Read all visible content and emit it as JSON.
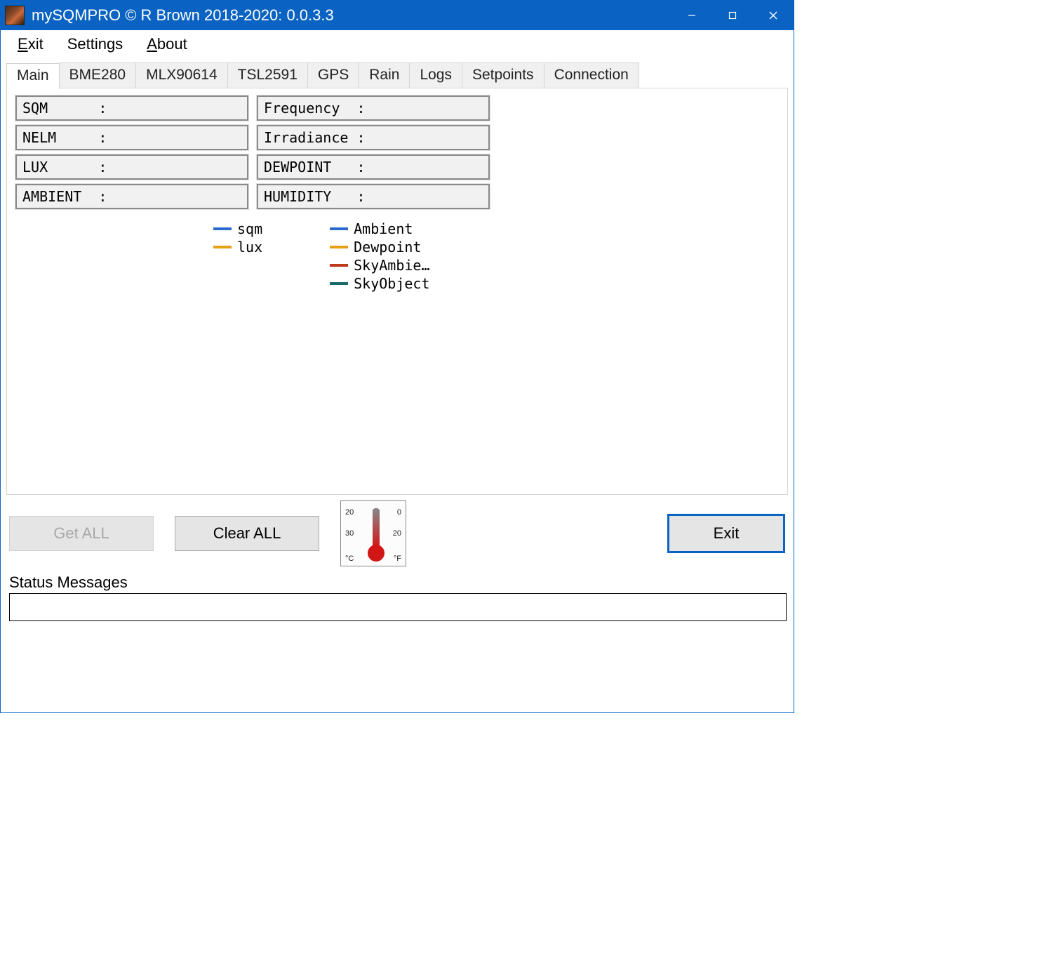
{
  "window": {
    "title": "mySQMPRO © R Brown 2018-2020: 0.0.3.3"
  },
  "menu": {
    "exit": "Exit",
    "settings": "Settings",
    "about": "About"
  },
  "tabs": {
    "main": "Main",
    "bme280": "BME280",
    "mlx90614": "MLX90614",
    "tsl2591": "TSL2591",
    "gps": "GPS",
    "rain": "Rain",
    "logs": "Logs",
    "setpoints": "Setpoints",
    "connection": "Connection"
  },
  "readouts": {
    "left": {
      "sqm": "SQM      :",
      "nelm": "NELM     :",
      "lux": "LUX      :",
      "ambient": "AMBIENT  :"
    },
    "right": {
      "frequency": "Frequency  :",
      "irradiance": "Irradiance :",
      "dewpoint": "DEWPOINT   :",
      "humidity": "HUMIDITY   :"
    }
  },
  "legend": {
    "left": [
      {
        "label": "sqm",
        "color": "#2a6ad0"
      },
      {
        "label": "lux",
        "color": "#e6a018"
      }
    ],
    "right": [
      {
        "label": "Ambient",
        "color": "#2a6ad0"
      },
      {
        "label": "Dewpoint",
        "color": "#e6a018"
      },
      {
        "label": "SkyAmbie…",
        "color": "#bf3a1c"
      },
      {
        "label": "SkyObject",
        "color": "#1b6a6a"
      }
    ]
  },
  "buttons": {
    "get_all": "Get   ALL",
    "clear_all": "Clear ALL",
    "exit": "Exit"
  },
  "thermo_ticks": {
    "tl": "20",
    "tr": "0",
    "ml": "30",
    "mr": "20",
    "bl": "°C",
    "br": "°F"
  },
  "status": {
    "label": "Status Messages",
    "value": ""
  }
}
